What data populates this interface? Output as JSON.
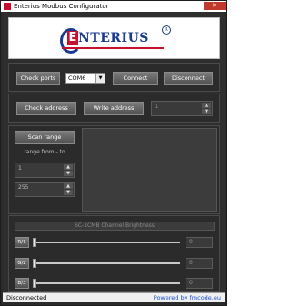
{
  "window": {
    "title": "Enterius Modbus Configurator",
    "close_label": "✕"
  },
  "logo": {
    "letter": "E",
    "text": "NTERIUS",
    "registered": "R"
  },
  "connection": {
    "check_ports_label": "Check ports",
    "port_value": "COM6",
    "connect_label": "Connect",
    "disconnect_label": "Disconnect"
  },
  "address": {
    "check_label": "Check address",
    "write_label": "Write address",
    "value": "1"
  },
  "scan": {
    "scan_label": "Scan range",
    "range_label": "range from - to",
    "from_value": "1",
    "to_value": "255"
  },
  "brightness": {
    "header": "SC-1CMB Channel Brightness",
    "channels": [
      {
        "name": "R/1",
        "value": "0",
        "level": 0
      },
      {
        "name": "G/2",
        "value": "0",
        "level": 0
      },
      {
        "name": "B/3",
        "value": "0",
        "level": 0
      }
    ]
  },
  "status": {
    "text": "Disconnected",
    "powered_by": "Powered by fmcode.eu"
  }
}
